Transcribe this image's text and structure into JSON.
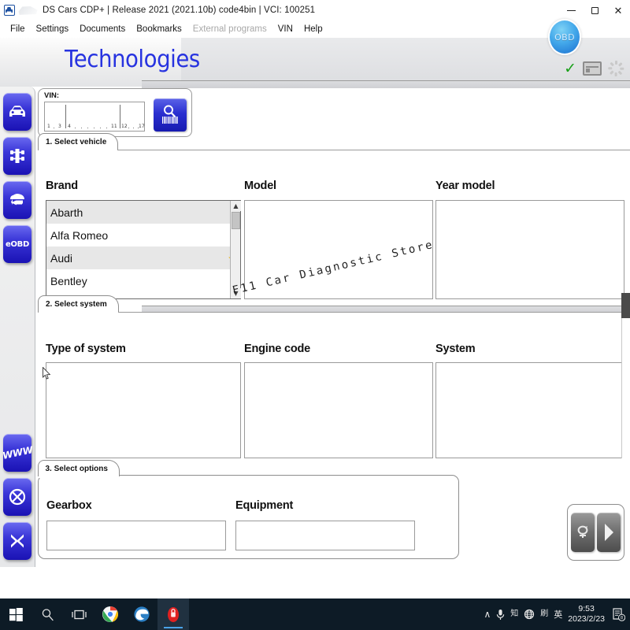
{
  "window": {
    "title": "DS Cars CDP+ | Release 2021 (2021.10b) code4bin  |  VCI: 100251",
    "app_icon": "car-document-icon",
    "minimize_label": "Minimize",
    "maximize_label": "Restore",
    "close_label": "Close"
  },
  "menubar": {
    "items": [
      {
        "label": "File",
        "disabled": false
      },
      {
        "label": "Settings",
        "disabled": false
      },
      {
        "label": "Documents",
        "disabled": false
      },
      {
        "label": "Bookmarks",
        "disabled": false
      },
      {
        "label": "External programs",
        "disabled": true
      },
      {
        "label": "VIN",
        "disabled": false
      },
      {
        "label": "Help",
        "disabled": false
      }
    ]
  },
  "header": {
    "brand": "Technologies",
    "brand_color": "#2733e0",
    "obd_badge": "OBD",
    "status": {
      "connected_check": "✓",
      "check_color": "#18a018",
      "vci_icon": "vci-device-icon",
      "spinner_icon": "loading-spinner-icon"
    }
  },
  "sidebar": {
    "items": [
      {
        "name": "cars-mode",
        "icon": "car-icon",
        "text": ""
      },
      {
        "name": "trucks-mode",
        "icon": "truck-axle-icon",
        "text": ""
      },
      {
        "name": "van-back-mode",
        "icon": "van-arrow-icon",
        "text": ""
      },
      {
        "name": "eobd-mode",
        "icon": "eobd-text-icon",
        "text": "eOBD"
      }
    ],
    "bottom_items": [
      {
        "name": "www-link",
        "icon": "www-icon",
        "text": "WWW"
      },
      {
        "name": "disconnect",
        "icon": "circle-x-icon",
        "text": ""
      },
      {
        "name": "exit",
        "icon": "x-icon",
        "text": ""
      }
    ]
  },
  "vin_panel": {
    "label": "VIN:",
    "value": "",
    "placeholder": "",
    "search_button": "vin-search-button",
    "ticks": [
      "1",
      "3",
      "4",
      "11",
      "12",
      "17"
    ]
  },
  "sections": [
    {
      "tab": "1. Select vehicle",
      "fields": [
        {
          "name": "brand",
          "label": "Brand",
          "value": ""
        },
        {
          "name": "model",
          "label": "Model",
          "value": ""
        },
        {
          "name": "year-model",
          "label": "Year model",
          "value": ""
        }
      ]
    },
    {
      "tab": "2. Select system",
      "fields": [
        {
          "name": "type-of-system",
          "label": "Type of system",
          "value": ""
        },
        {
          "name": "engine-code",
          "label": "Engine code",
          "value": ""
        },
        {
          "name": "system",
          "label": "System",
          "value": ""
        }
      ]
    },
    {
      "tab": "3. Select options",
      "fields": [
        {
          "name": "gearbox",
          "label": "Gearbox",
          "value": ""
        },
        {
          "name": "equipment",
          "label": "Equipment",
          "value": ""
        }
      ]
    }
  ],
  "brand_list": {
    "items": [
      {
        "label": "Abarth",
        "favorite": false,
        "selected": false
      },
      {
        "label": "Alfa Romeo",
        "favorite": false,
        "selected": false
      },
      {
        "label": "Audi",
        "favorite": true,
        "selected": false
      },
      {
        "label": "Bentley",
        "favorite": false,
        "selected": false
      }
    ],
    "star_glyph": "★",
    "star_color": "#f0b400",
    "scroll_up": "▲",
    "scroll_down": "▼"
  },
  "actions": {
    "reset_button": "reset-icon",
    "next_button": "next-arrow-icon"
  },
  "watermark": {
    "text": "F11 Car Diagnostic Store"
  },
  "taskbar": {
    "items": [
      {
        "name": "start-button",
        "icon": "windows-logo-icon",
        "active": false
      },
      {
        "name": "search-button",
        "icon": "search-icon",
        "active": false
      },
      {
        "name": "task-view-button",
        "icon": "task-view-icon",
        "active": false
      },
      {
        "name": "chrome-button",
        "icon": "chrome-icon",
        "active": false
      },
      {
        "name": "edge-button",
        "icon": "edge-icon",
        "active": false
      },
      {
        "name": "diagnostic-app-button",
        "icon": "red-lock-app-icon",
        "active": true
      }
    ],
    "tray": {
      "overflow": "∧",
      "microphone": "microphone-icon",
      "ime_mode": "知",
      "globe": "globe-icon",
      "speaker": "刷",
      "language": "英",
      "time": "9:53",
      "date": "2023/2/23",
      "notifications": "8"
    }
  }
}
